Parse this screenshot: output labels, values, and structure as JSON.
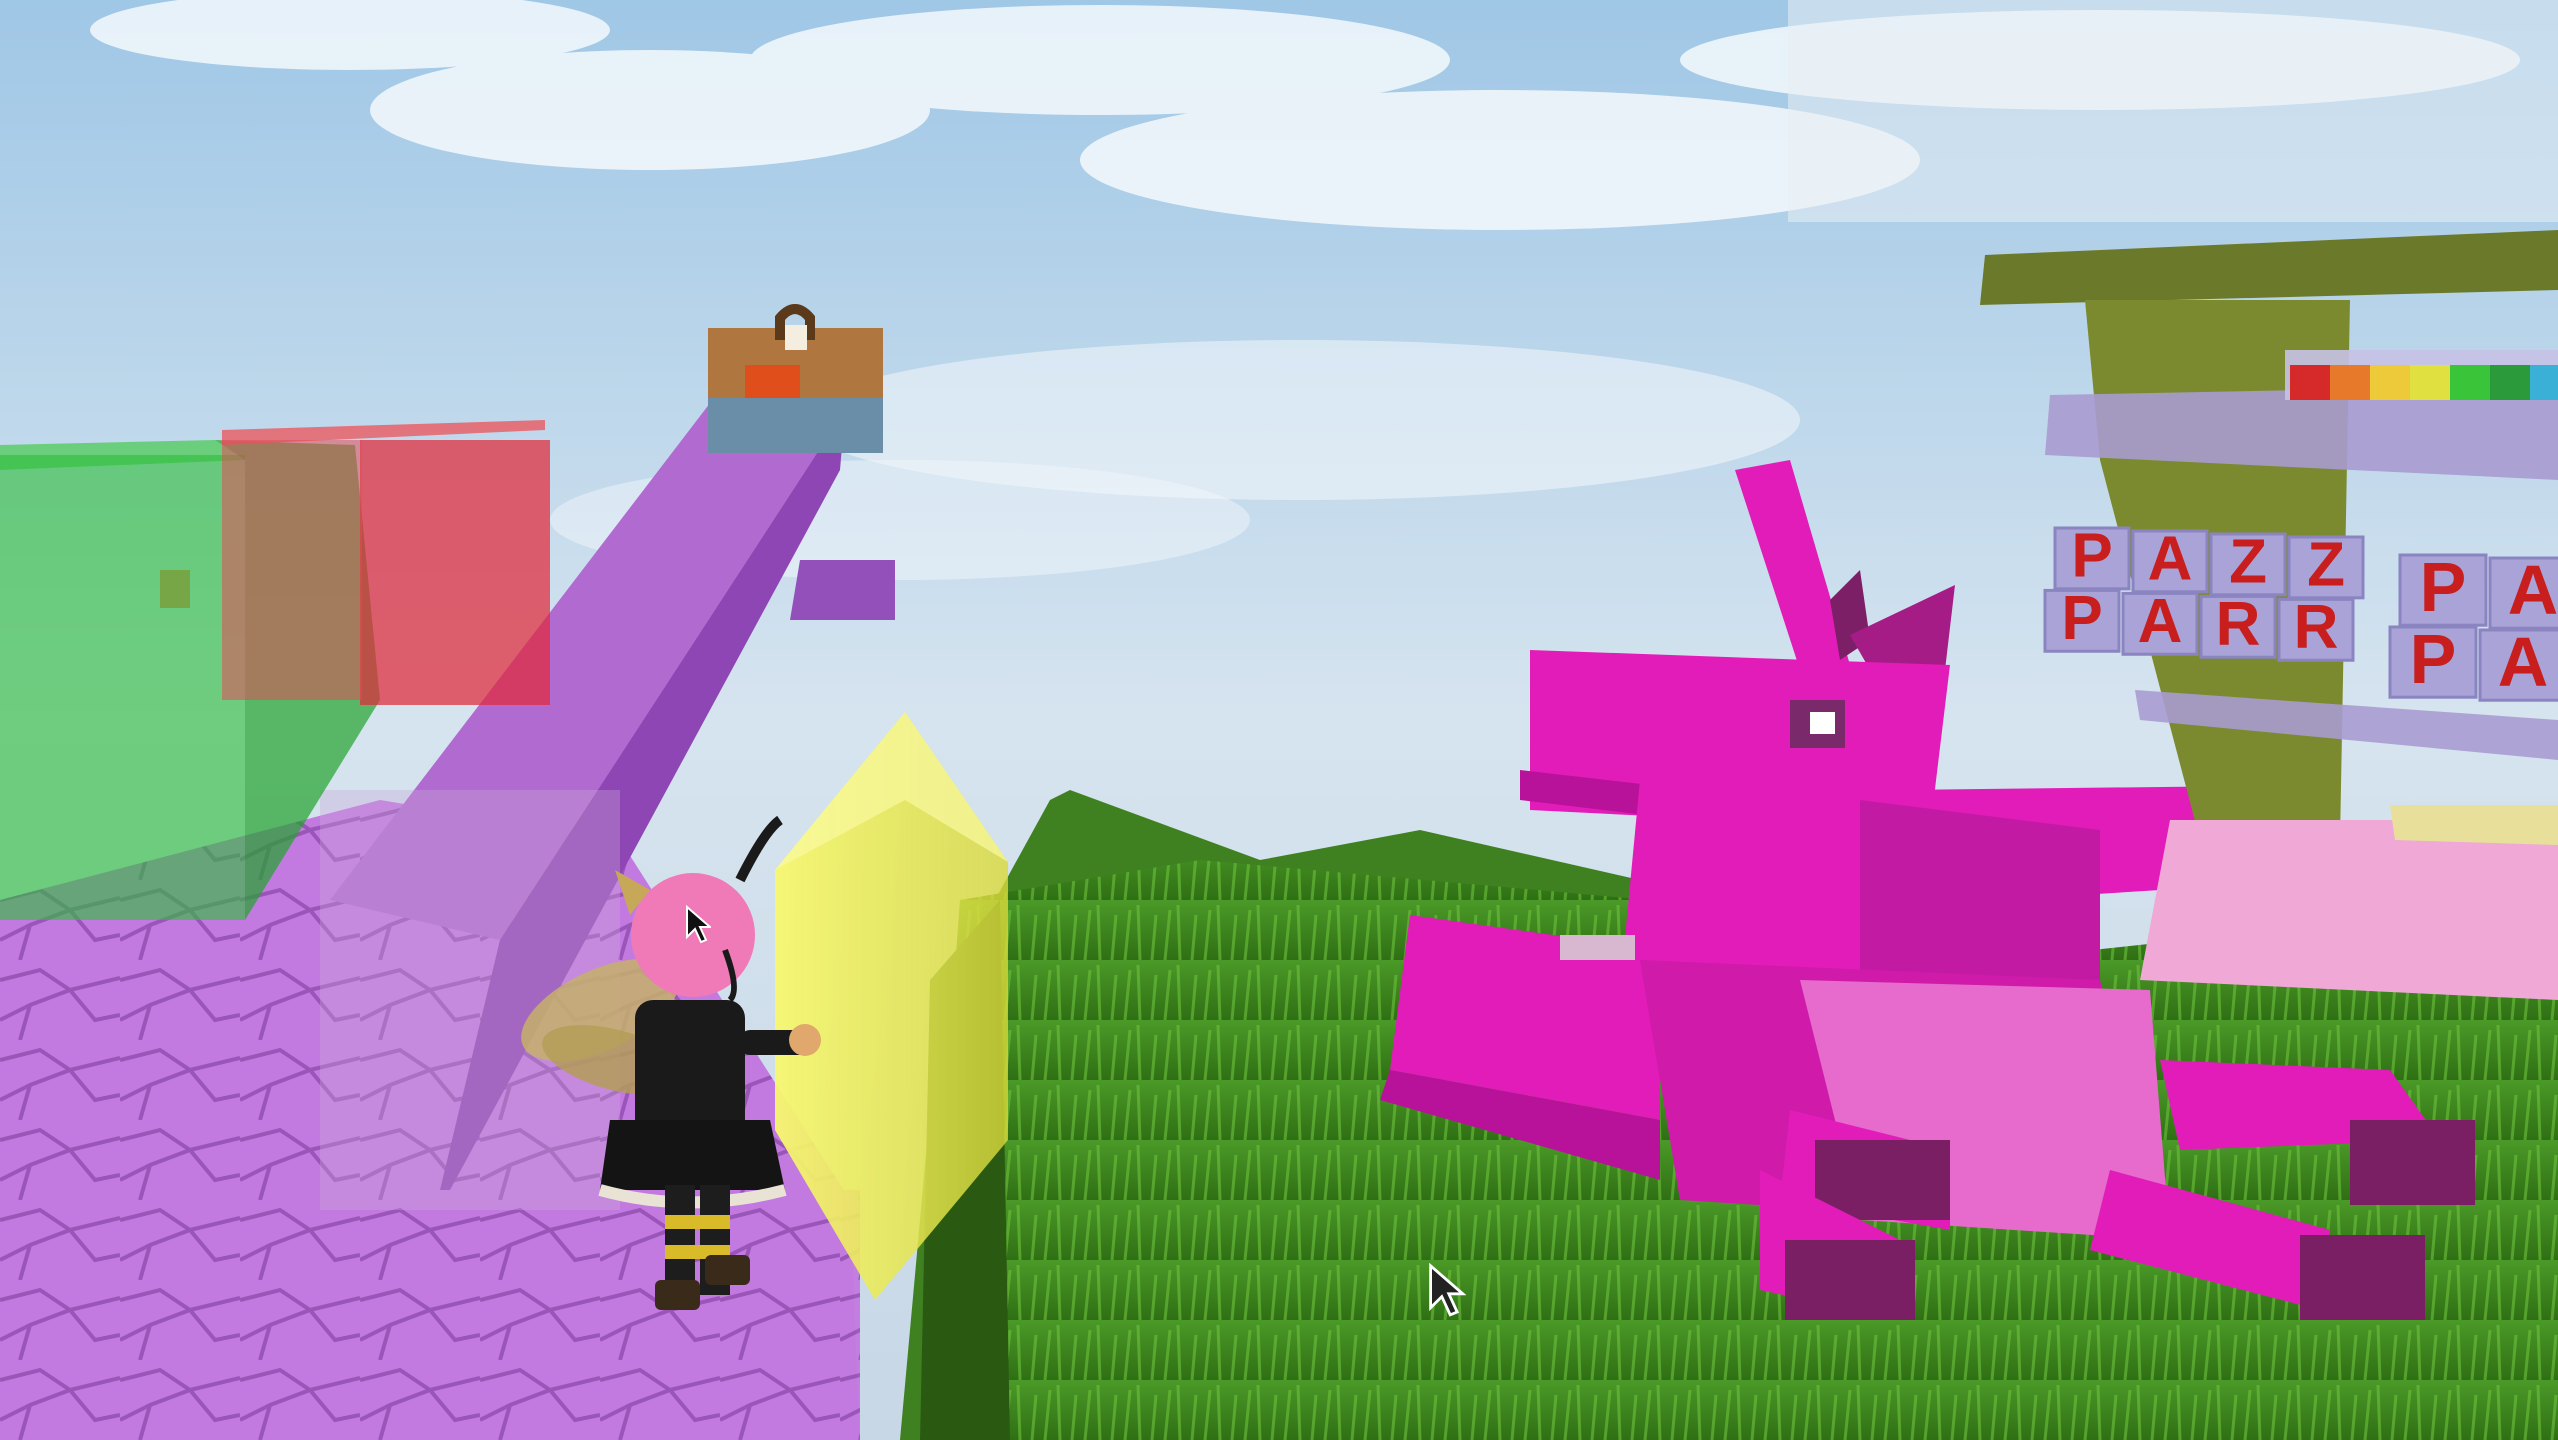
{
  "scene": {
    "type": "3d-game-viewport",
    "sign_rows": [
      [
        "P",
        "A",
        "Z",
        "Z"
      ],
      [
        "P",
        "A",
        "R",
        "R"
      ]
    ],
    "sign2_rows": [
      [
        "P",
        "A"
      ],
      [
        "P",
        "A"
      ]
    ],
    "colors": {
      "sky": "#bcd6ea",
      "grass": "#3f8a1f",
      "platform": "#b26bd6",
      "unicorn": "#e21cb8",
      "crystal": "#f0f040",
      "green_block": "#2fbf3a",
      "red_block": "#e02a3a"
    },
    "icons": [
      "arrow-cursor-icon",
      "arrow-cursor-icon"
    ]
  }
}
